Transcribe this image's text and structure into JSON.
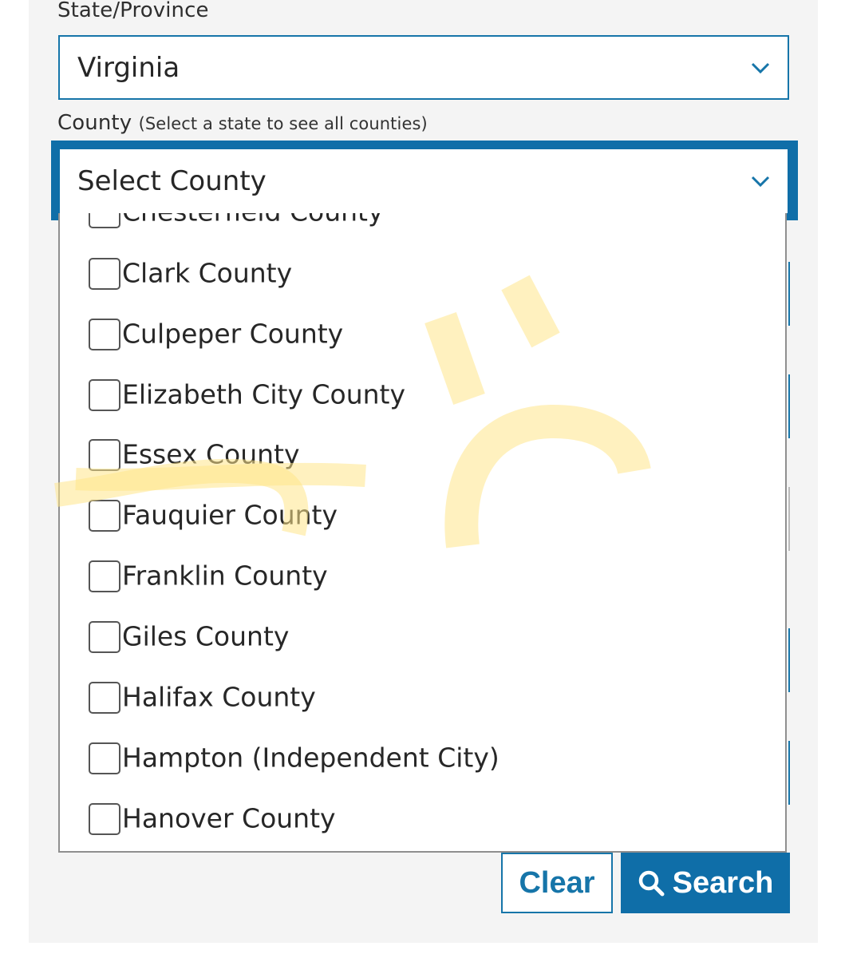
{
  "state_field": {
    "label": "State/Province",
    "value": "Virginia",
    "chevron_icon": "chevron-down-icon"
  },
  "county_field": {
    "label": "County",
    "hint": "(Select a state to see all counties)",
    "placeholder": "Select County",
    "chevron_icon": "chevron-down-icon"
  },
  "county_options": [
    "Chesterfield County",
    "Clark County",
    "Culpeper County",
    "Elizabeth City County",
    "Essex County",
    "Fauquier County",
    "Franklin County",
    "Giles County",
    "Halifax County",
    "Hampton (Independent City)",
    "Hanover County"
  ],
  "buttons": {
    "clear_label": "Clear",
    "search_label": "Search",
    "search_icon": "search-icon"
  },
  "colors": {
    "accent": "#0f6ea8",
    "border": "#1675a9",
    "panel_bg": "#f4f4f4",
    "highlighter": "#ffe58a"
  }
}
